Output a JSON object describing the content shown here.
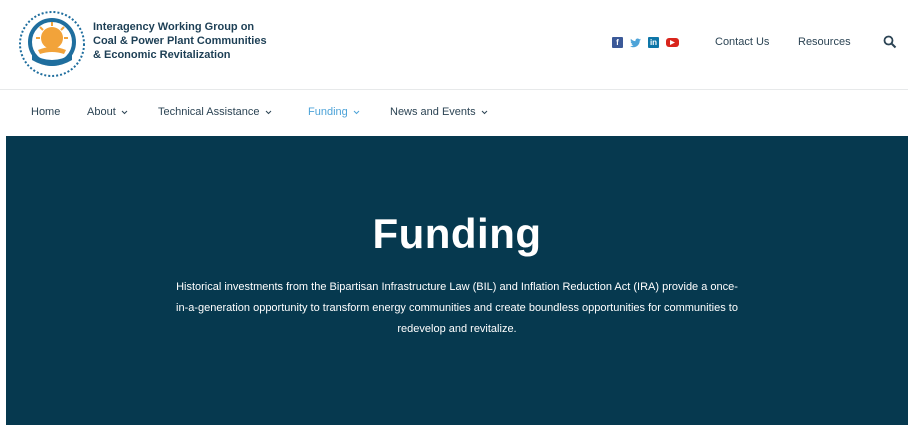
{
  "header": {
    "org_name_lines": [
      "Interagency Working Group on",
      "Coal & Power Plant Communities",
      "& Economic Revitalization"
    ],
    "social_icons": [
      "facebook-icon",
      "twitter-icon",
      "linkedin-icon",
      "youtube-icon"
    ],
    "contact_label": "Contact Us",
    "resources_label": "Resources",
    "search_icon": "search-icon"
  },
  "nav": {
    "items": [
      {
        "label": "Home",
        "has_dropdown": false
      },
      {
        "label": "About",
        "has_dropdown": true
      },
      {
        "label": "Technical Assistance",
        "has_dropdown": true
      },
      {
        "label": "Funding",
        "has_dropdown": true,
        "active": true
      },
      {
        "label": "News and Events",
        "has_dropdown": true
      }
    ]
  },
  "hero": {
    "title": "Funding",
    "text": "Historical investments from the Bipartisan Infrastructure Law (BIL) and Inflation Reduction Act (IRA) provide a once-in-a-generation opportunity to transform energy communities and create boundless opportunities for communities to redevelop and revitalize."
  },
  "colors": {
    "hero_bg": "#06394f",
    "nav_active": "#4da3d8",
    "text_dark": "#2c4454",
    "logo_orange": "#f2a33a",
    "logo_blue": "#1f6e9e"
  }
}
